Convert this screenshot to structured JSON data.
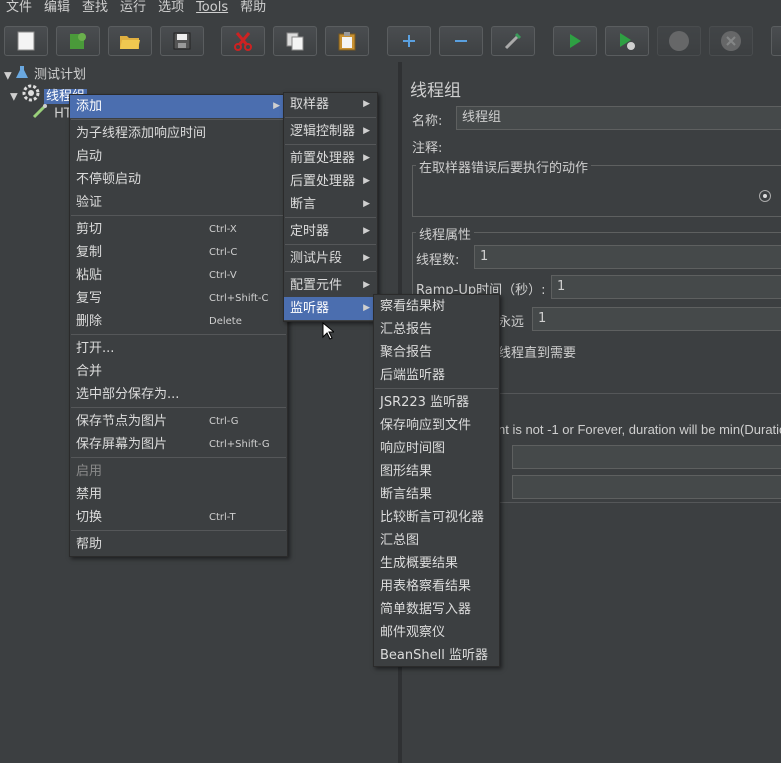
{
  "menubar": [
    "文件",
    "编辑",
    "查找",
    "运行",
    "选项",
    "Tools",
    "帮助"
  ],
  "tree": {
    "root": "测试计划",
    "group": "线程组",
    "child": "HT"
  },
  "right": {
    "title": "线程组",
    "name_label": "名称:",
    "name_value": "线程组",
    "comment_label": "注释:",
    "error_section": "在取样器错误后要执行的动作",
    "props_section": "线程属性",
    "threads_label": "线程数:",
    "threads_value": "1",
    "rampup_label": "Ramp-Up时间（秒）:",
    "rampup_value": "1",
    "loop_fragment": "永远",
    "loop_value": "1",
    "delay_fragment": "线程直到需要",
    "duration_note": "nt is not -1 or Forever, duration will be min(Duratio"
  },
  "context_menu": {
    "items": [
      {
        "label": "添加",
        "submenu": true
      },
      {
        "label": "为子线程添加响应时间"
      },
      {
        "label": "启动"
      },
      {
        "label": "不停顿启动"
      },
      {
        "label": "验证"
      },
      {
        "label": "剪切",
        "shortcut": "Ctrl-X"
      },
      {
        "label": "复制",
        "shortcut": "Ctrl-C"
      },
      {
        "label": "粘贴",
        "shortcut": "Ctrl-V"
      },
      {
        "label": "复写",
        "shortcut": "Ctrl+Shift-C"
      },
      {
        "label": "删除",
        "shortcut": "Delete"
      },
      {
        "label": "打开..."
      },
      {
        "label": "合并"
      },
      {
        "label": "选中部分保存为..."
      },
      {
        "label": "保存节点为图片",
        "shortcut": "Ctrl-G"
      },
      {
        "label": "保存屏幕为图片",
        "shortcut": "Ctrl+Shift-G"
      },
      {
        "label": "启用"
      },
      {
        "label": "禁用"
      },
      {
        "label": "切换",
        "shortcut": "Ctrl-T"
      },
      {
        "label": "帮助"
      }
    ]
  },
  "add_submenu": {
    "items": [
      "取样器",
      "逻辑控制器",
      "前置处理器",
      "后置处理器",
      "断言",
      "定时器",
      "测试片段",
      "配置元件",
      "监听器"
    ]
  },
  "listener_submenu": {
    "items": [
      "察看结果树",
      "汇总报告",
      "聚合报告",
      "后端监听器",
      "JSR223 监听器",
      "保存响应到文件",
      "响应时间图",
      "图形结果",
      "断言结果",
      "比较断言可视化器",
      "汇总图",
      "生成概要结果",
      "用表格察看结果",
      "简单数据写入器",
      "邮件观察仪",
      "BeanShell 监听器"
    ]
  },
  "colors": {
    "highlight": "#4b6eaf",
    "background": "#3c3f41",
    "text": "#dcdcdc"
  }
}
